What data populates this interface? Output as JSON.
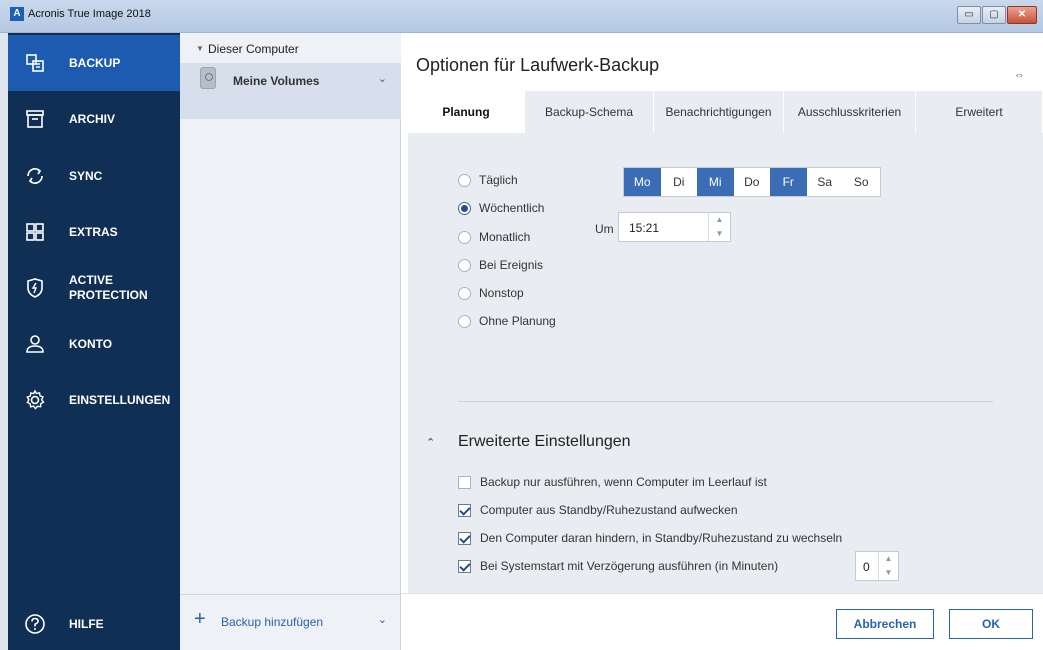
{
  "window": {
    "title": "Acronis True Image 2018",
    "logo": "A",
    "buttons": {
      "minimize": "▭",
      "maximize": "▢",
      "close": "✕"
    }
  },
  "nav": {
    "items": [
      {
        "label": "BACKUP",
        "icon": "backup-icon",
        "active": true
      },
      {
        "label": "ARCHIV",
        "icon": "archive-icon"
      },
      {
        "label": "SYNC",
        "icon": "sync-icon"
      },
      {
        "label": "EXTRAS",
        "icon": "tools-grid-icon"
      },
      {
        "label": "ACTIVE PROTECTION",
        "icon": "shield-icon"
      },
      {
        "label": "KONTO",
        "icon": "user-icon"
      },
      {
        "label": "EINSTELLUNGEN",
        "icon": "gear-icon"
      }
    ],
    "help_label": "HILFE",
    "colors": {
      "background": "#0f2f55",
      "active": "#1c5bb0"
    }
  },
  "sources": {
    "group_label": "Dieser Computer",
    "item_label": "Meine Volumes",
    "add_label": "Backup hinzufügen"
  },
  "main": {
    "title": "Optionen für Laufwerk-Backup",
    "tabs": [
      "Planung",
      "Backup-Schema",
      "Benachrichtigungen",
      "Ausschlusskriterien",
      "Erweitert"
    ],
    "active_tab": "Planung"
  },
  "schedule": {
    "options": [
      "Täglich",
      "Wöchentlich",
      "Monatlich",
      "Bei Ereignis",
      "Nonstop",
      "Ohne Planung"
    ],
    "selected": "Wöchentlich",
    "days": [
      {
        "label": "Mo",
        "on": true
      },
      {
        "label": "Di",
        "on": false
      },
      {
        "label": "Mi",
        "on": true
      },
      {
        "label": "Do",
        "on": false
      },
      {
        "label": "Fr",
        "on": true
      },
      {
        "label": "Sa",
        "on": false
      },
      {
        "label": "So",
        "on": false
      }
    ],
    "time_label": "Um",
    "time_value": "15:21"
  },
  "advanced": {
    "title": "Erweiterte Einstellungen",
    "options": [
      {
        "label": "Backup nur ausführen, wenn Computer im Leerlauf ist",
        "checked": false
      },
      {
        "label": "Computer aus Standby/Ruhezustand aufwecken",
        "checked": true
      },
      {
        "label": "Den Computer daran hindern, in Standby/Ruhezustand zu wechseln",
        "checked": true
      },
      {
        "label": "Bei Systemstart mit Verzögerung ausführen (in Minuten)",
        "checked": true
      }
    ],
    "delay_value": "0"
  },
  "footer": {
    "cancel_label": "Abbrechen",
    "ok_label": "OK"
  },
  "accent_color": "#2a62b0"
}
